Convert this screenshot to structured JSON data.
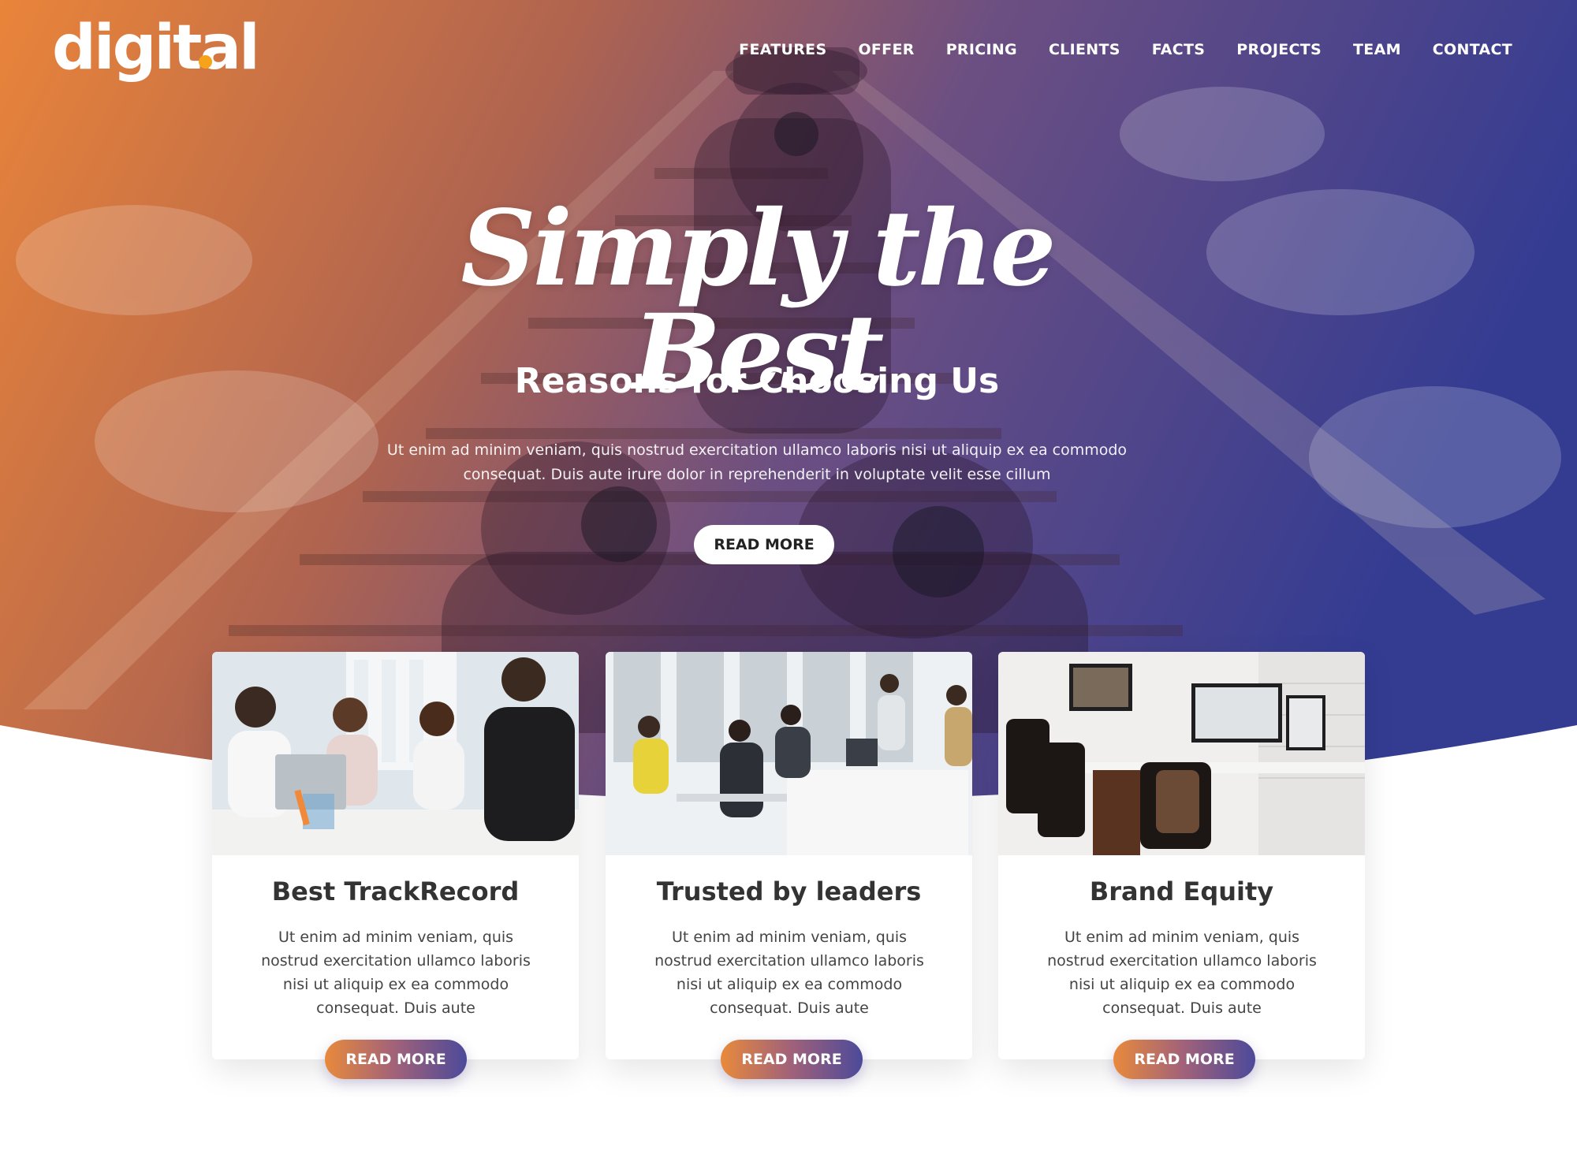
{
  "brand": {
    "logo": "digital",
    "dot_color": "#f5a31b"
  },
  "nav": {
    "items": [
      "FEATURES",
      "OFFER",
      "PRICING",
      "CLIENTS",
      "FACTS",
      "PROJECTS",
      "TEAM",
      "CONTACT"
    ]
  },
  "hero": {
    "script_title": "Simply the Best",
    "title": "Reasons for Choosing Us",
    "description": "Ut enim ad minim veniam, quis nostrud exercitation ullamco laboris nisi ut aliquip ex ea commodo consequat. Duis aute irure dolor in reprehenderit in voluptate velit esse cillum",
    "button": "READ MORE",
    "gradient": {
      "left": "#e8853a",
      "right": "#3a3d8f"
    }
  },
  "cards": [
    {
      "title": "Best TrackRecord",
      "text": "Ut enim ad minim veniam, quis nostrud exercitation ullamco laboris nisi ut aliquip ex ea commodo consequat. Duis aute",
      "button": "READ MORE"
    },
    {
      "title": "Trusted by leaders",
      "text": "Ut enim ad minim veniam, quis nostrud exercitation ullamco laboris nisi ut aliquip ex ea commodo consequat. Duis aute",
      "button": "READ MORE"
    },
    {
      "title": "Brand Equity",
      "text": "Ut enim ad minim veniam, quis nostrud exercitation ullamco laboris nisi ut aliquip ex ea commodo consequat. Duis aute",
      "button": "READ MORE"
    }
  ]
}
